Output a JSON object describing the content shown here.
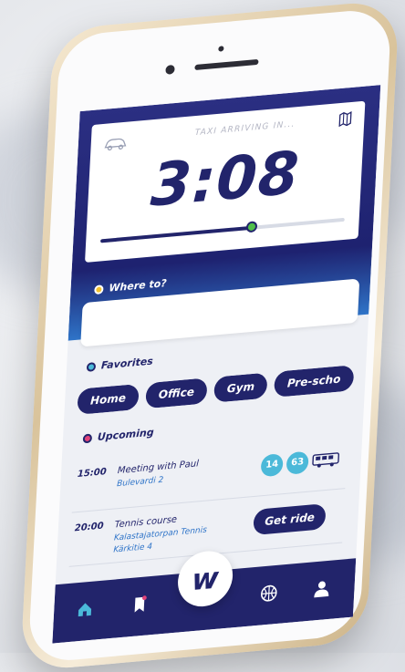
{
  "timer": {
    "label": "TAXI ARRIVING IN...",
    "value": "3:08",
    "progress": 0.62
  },
  "where_to": {
    "label": "Where to?",
    "value": "",
    "placeholder": ""
  },
  "favorites": {
    "label": "Favorites",
    "chips": [
      "Home",
      "Office",
      "Gym",
      "Pre-scho"
    ]
  },
  "upcoming": {
    "label": "Upcoming",
    "items": [
      {
        "time": "15:00",
        "title": "Meeting with Paul",
        "location": "Bulevardi 2",
        "bus_routes": [
          "14",
          "63"
        ]
      },
      {
        "time": "20:00",
        "title": "Tennis course",
        "location": "Kalastajatorpan Tennis Kärkitie 4",
        "action": "Get ride"
      }
    ]
  },
  "nav": {
    "center_logo": "w",
    "icons": [
      "home-icon",
      "bookmark-icon",
      "w-logo-icon",
      "basketball-icon",
      "profile-icon"
    ]
  },
  "colors": {
    "primary": "#22246b",
    "accent_blue": "#2f74c8",
    "badge": "#4bb9d9",
    "progress_knob": "#4fbf4a",
    "phone_gold": "#d9c39b"
  }
}
